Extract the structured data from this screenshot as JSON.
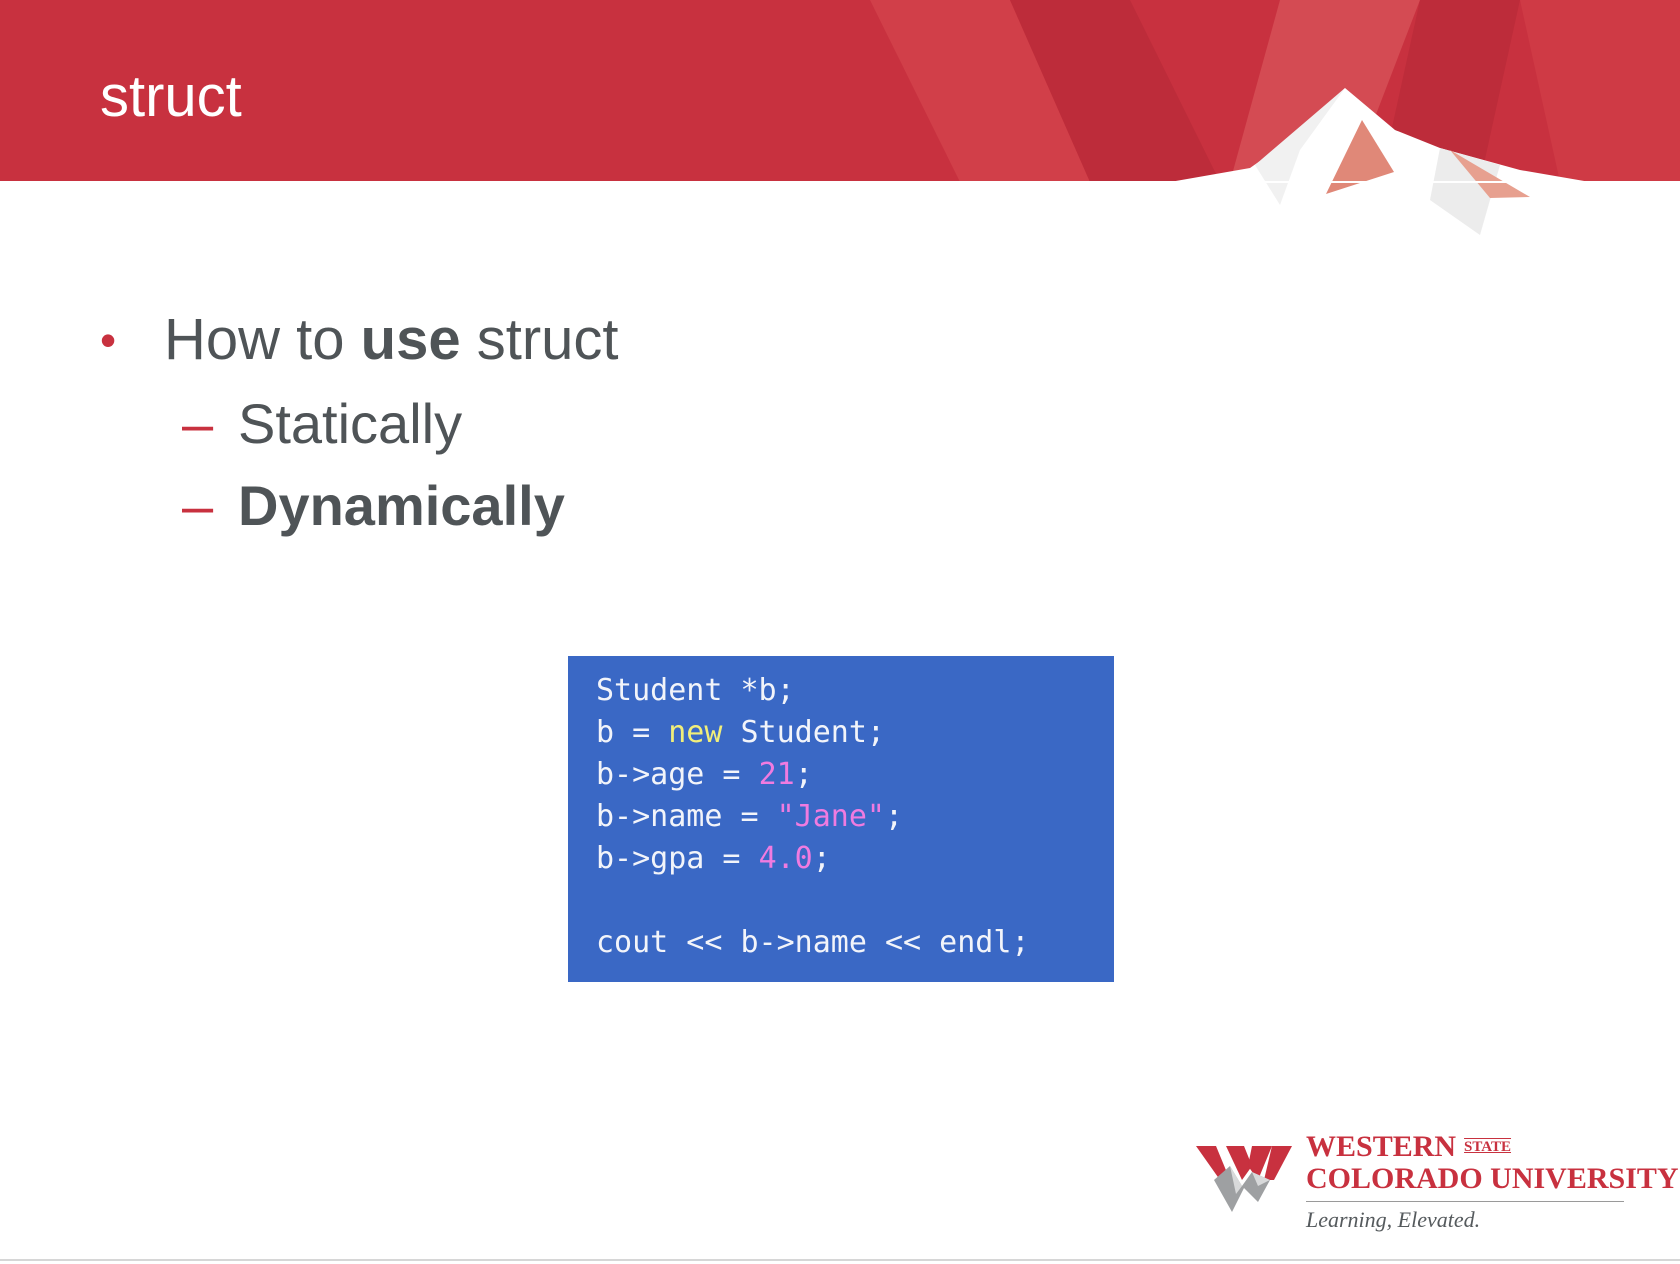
{
  "slide": {
    "title": "struct",
    "bullet": {
      "prefix": "How to ",
      "bold": "use",
      "suffix": " struct"
    },
    "sub_bullets": [
      {
        "text": "Statically",
        "bold": false
      },
      {
        "text": "Dynamically",
        "bold": true
      }
    ]
  },
  "code": {
    "lines": [
      [
        {
          "t": "Student *b;",
          "c": ""
        }
      ],
      [
        {
          "t": "b = ",
          "c": ""
        },
        {
          "t": "new",
          "c": "kw"
        },
        {
          "t": " Student;",
          "c": ""
        }
      ],
      [
        {
          "t": "b->age = ",
          "c": ""
        },
        {
          "t": "21",
          "c": "num"
        },
        {
          "t": ";",
          "c": ""
        }
      ],
      [
        {
          "t": "b->name = ",
          "c": ""
        },
        {
          "t": "\"Jane\"",
          "c": "str"
        },
        {
          "t": ";",
          "c": ""
        }
      ],
      [
        {
          "t": "b->gpa = ",
          "c": ""
        },
        {
          "t": "4.0",
          "c": "num"
        },
        {
          "t": ";",
          "c": ""
        }
      ],
      [],
      [
        {
          "t": "cout << b->name << endl;",
          "c": ""
        }
      ]
    ]
  },
  "logo": {
    "line1": "WESTERN",
    "state": "STATE",
    "line2": "COLORADO UNIVERSITY",
    "tagline": "Learning, Elevated."
  },
  "colors": {
    "header_red": "#c8313f",
    "bullet_red": "#c8313f",
    "code_bg": "#3a68c5",
    "keyword": "#f1ee7a",
    "literal": "#f07be0"
  }
}
